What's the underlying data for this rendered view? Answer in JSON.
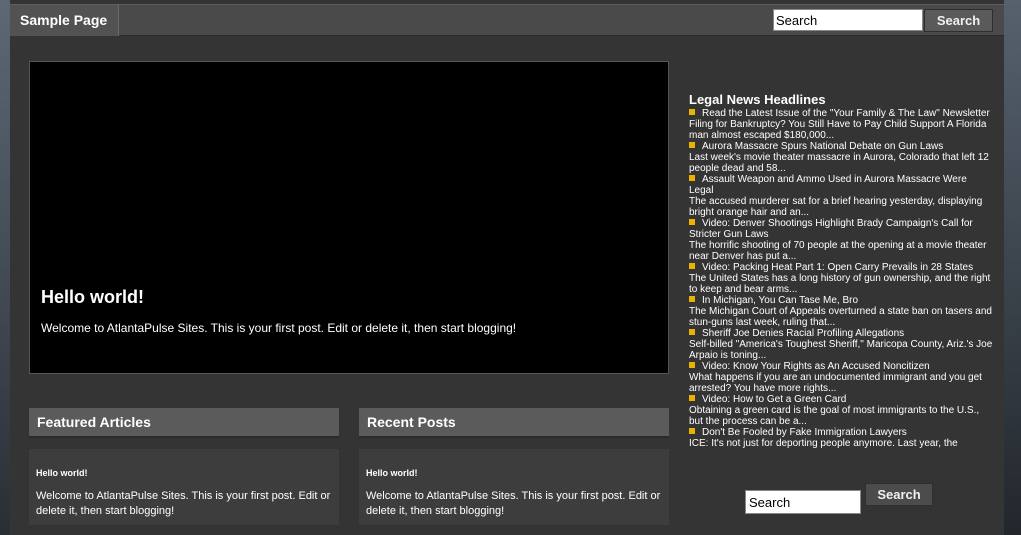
{
  "header": {
    "site_title": "Sample Page",
    "search_value": "Search",
    "search_button": "Search"
  },
  "hero": {
    "title": "Hello world!",
    "text": "Welcome to AtlantaPulse Sites. This is your first post. Edit or delete it, then start blogging!"
  },
  "featured": {
    "heading": "Featured Articles",
    "post_title": "Hello world!",
    "post_text": "Welcome to AtlantaPulse Sites. This is your first post. Edit or delete it, then start blogging!"
  },
  "recent": {
    "heading": "Recent Posts",
    "post_title": "Hello world!",
    "post_text": "Welcome to AtlantaPulse Sites. This is your first post. Edit or delete it, then start blogging!"
  },
  "sidebar": {
    "title": "Legal News Headlines",
    "bullet_color": "#e8b400",
    "news": [
      {
        "head": "Read the Latest Issue of the \"Your Family & The Law\" Newsletter",
        "desc": "Filing for Bankruptcy? You Still Have to Pay Child Support A Florida man almost escaped $180,000..."
      },
      {
        "head": "Aurora Massacre Spurs National Debate on Gun Laws",
        "desc": "Last week's movie theater massacre in Aurora, Colorado that left 12 people dead and 58..."
      },
      {
        "head": "Assault Weapon and Ammo Used in Aurora Massacre Were Legal",
        "desc": "The accused murderer sat for a brief hearing yesterday, displaying bright orange hair and an..."
      },
      {
        "head": "Video: Denver Shootings Highlight Brady Campaign's Call for Stricter Gun Laws",
        "desc": "  The horrific shooting of 70 people at the opening at a movie theater near Denver has put a..."
      },
      {
        "head": "Video: Packing Heat Part 1: Open Carry Prevails in 28 States",
        "desc": "  The United States has a long history of gun ownership, and the right to keep and bear arms..."
      },
      {
        "head": "In Michigan, You Can Tase Me, Bro",
        "desc": "The Michigan Court of Appeals overturned a state ban on tasers and stun-guns last week, ruling that..."
      },
      {
        "head": "Sheriff Joe Denies Racial Profiling Allegations",
        "desc": "Self-billed \"America's Toughest Sheriff,\" Maricopa County, Ariz.'s Joe Arpaio is toning..."
      },
      {
        "head": "Video: Know Your Rights as An Accused Noncitizen",
        "desc": "  What happens if you are an undocumented immigrant and you get arrested? You have more rights..."
      },
      {
        "head": "Video: How to Get a Green Card",
        "desc": "  Obtaining a green card is the goal of most immigrants to the U.S., but the process can be a..."
      },
      {
        "head": "Don't Be Fooled by Fake Immigration Lawyers",
        "desc": "ICE: It's not just for deporting people anymore. Last year, the"
      }
    ],
    "search_value": "Search",
    "search_button": "Search"
  }
}
